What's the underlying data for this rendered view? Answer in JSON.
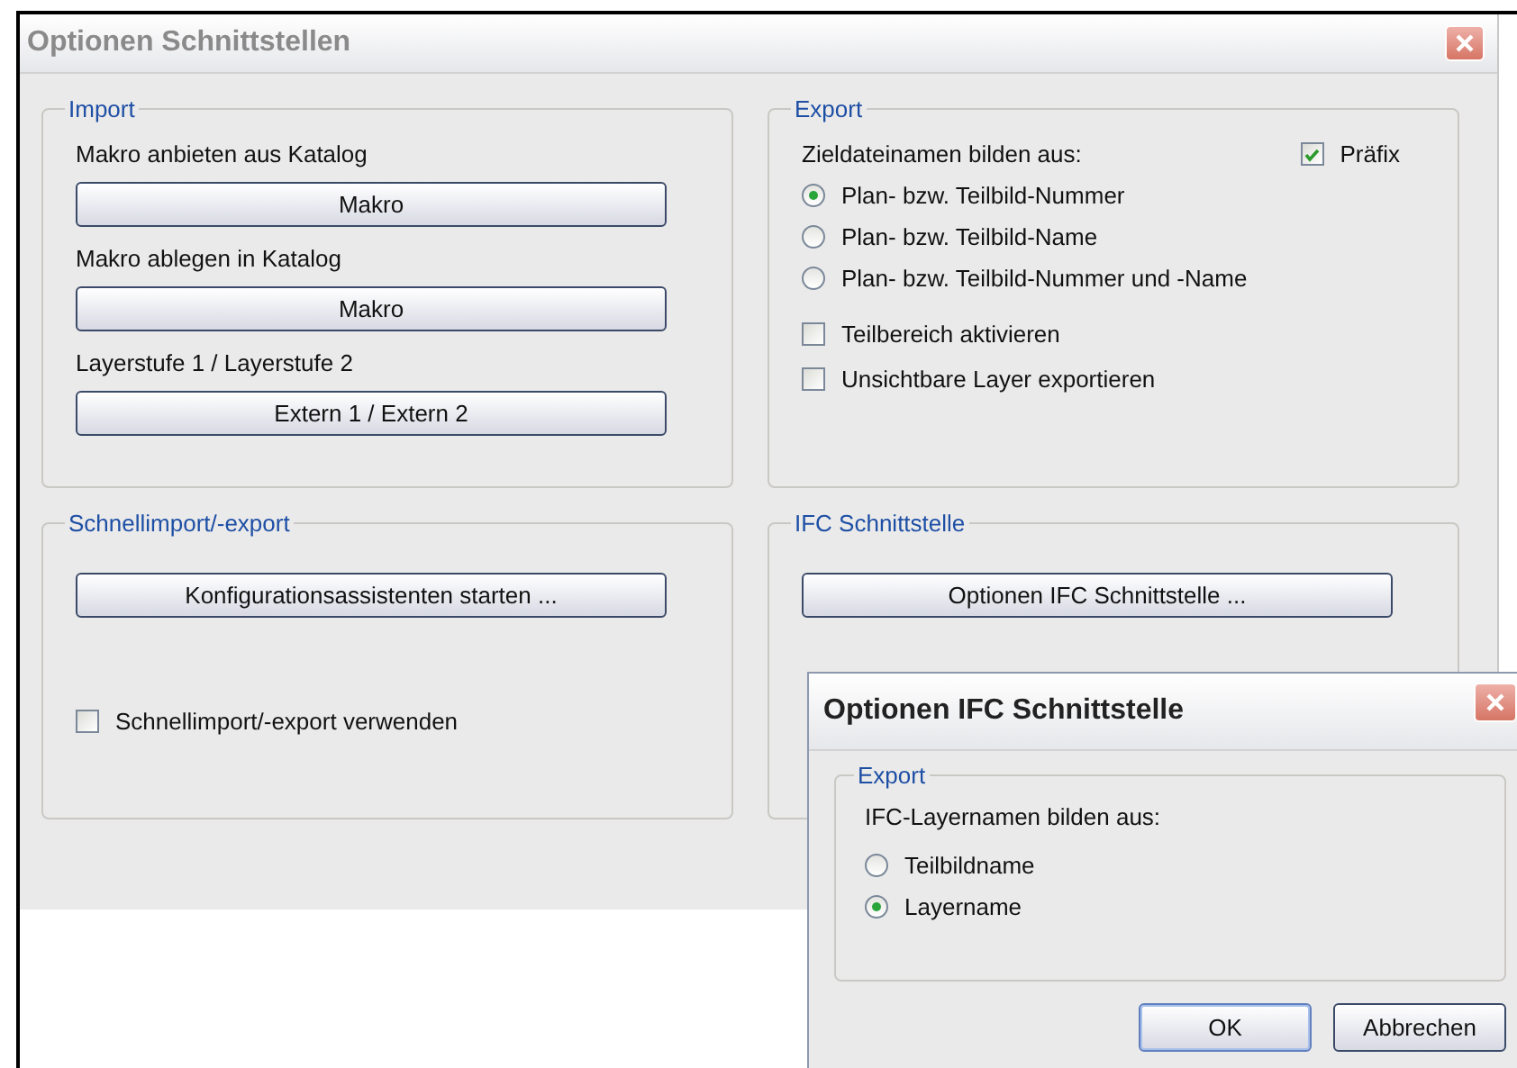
{
  "window": {
    "title": "Optionen Schnittstellen"
  },
  "import": {
    "title": "Import",
    "rows": [
      {
        "label": "Makro anbieten aus Katalog",
        "button": "Makro"
      },
      {
        "label": "Makro ablegen in Katalog",
        "button": "Makro"
      },
      {
        "label": "Layerstufe 1 / Layerstufe 2",
        "button": "Extern 1 / Extern 2"
      }
    ]
  },
  "export": {
    "title": "Export",
    "prompt": "Zieldateinamen bilden aus:",
    "prefix": {
      "label": "Präfix",
      "checked": true
    },
    "options": [
      {
        "label": "Plan- bzw. Teilbild-Nummer",
        "selected": true
      },
      {
        "label": "Plan- bzw. Teilbild-Name",
        "selected": false
      },
      {
        "label": "Plan- bzw. Teilbild-Nummer und -Name",
        "selected": false
      }
    ],
    "checks": [
      {
        "label": "Teilbereich aktivieren",
        "checked": false
      },
      {
        "label": "Unsichtbare Layer exportieren",
        "checked": false
      }
    ]
  },
  "quick": {
    "title": "Schnellimport/-export",
    "button": "Konfigurationsassistenten starten ...",
    "check": {
      "label": "Schnellimport/-export verwenden",
      "checked": false
    }
  },
  "ifc": {
    "title": "IFC Schnittstelle",
    "button": "Optionen IFC Schnittstelle ..."
  },
  "dialog": {
    "title": "Optionen IFC Schnittstelle",
    "group": "Export",
    "prompt": "IFC-Layernamen bilden aus:",
    "options": [
      {
        "label": "Teilbildname",
        "selected": false
      },
      {
        "label": "Layername",
        "selected": true
      }
    ],
    "buttons": [
      "OK",
      "Abbrechen"
    ]
  }
}
